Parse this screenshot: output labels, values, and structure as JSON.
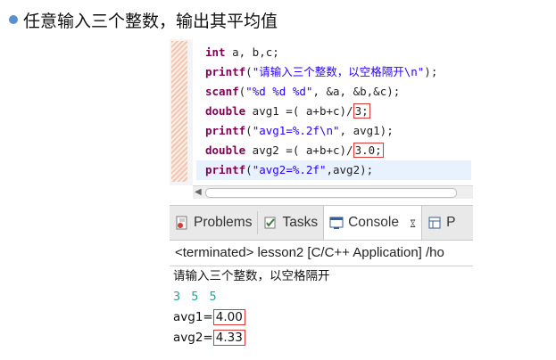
{
  "slide": {
    "title": "任意输入三个整数，输出其平均值"
  },
  "editor": {
    "lines": [
      {
        "kw": "int",
        "rest": " a, b,c;"
      },
      {
        "fn": "printf",
        "open": "(",
        "str": "\"请输入三个整数，以空格隔开\\n\"",
        "close": ");"
      },
      {
        "fn": "scanf",
        "open": "(",
        "str": "\"%d %d %d\"",
        "close": ", &a, &b,&c);"
      },
      {
        "kw": "double",
        "mid": " avg1 =( a+b+c)/",
        "boxed": "3;"
      },
      {
        "fn": "printf",
        "open": "(",
        "str": "\"avg1=%.2f\\n\"",
        "close": ", avg1);"
      },
      {
        "kw": "double",
        "mid": " avg2 =( a+b+c)/",
        "boxed": "3.0;"
      },
      {
        "fn": "printf",
        "open": "(",
        "str": "\"avg2=%.2f\"",
        "close": ",avg2);"
      }
    ]
  },
  "tabs": {
    "problems": "Problems",
    "tasks": "Tasks",
    "console": "Console",
    "close": "ೱ",
    "partial": "P"
  },
  "console": {
    "header": "<terminated> lesson2 [C/C++ Application] /ho",
    "prompt_output": "请输入三个整数，以空格隔开",
    "user_input": "3 5 5",
    "avg1_label": "avg1=",
    "avg1_value": "4.00",
    "avg2_label": "avg2=",
    "avg2_value": "4.33"
  },
  "colors": {
    "keyword": "#7f0055",
    "string": "#2a00ff",
    "highlight_box": "#d93a3a",
    "bullet": "#5b8fd0"
  }
}
